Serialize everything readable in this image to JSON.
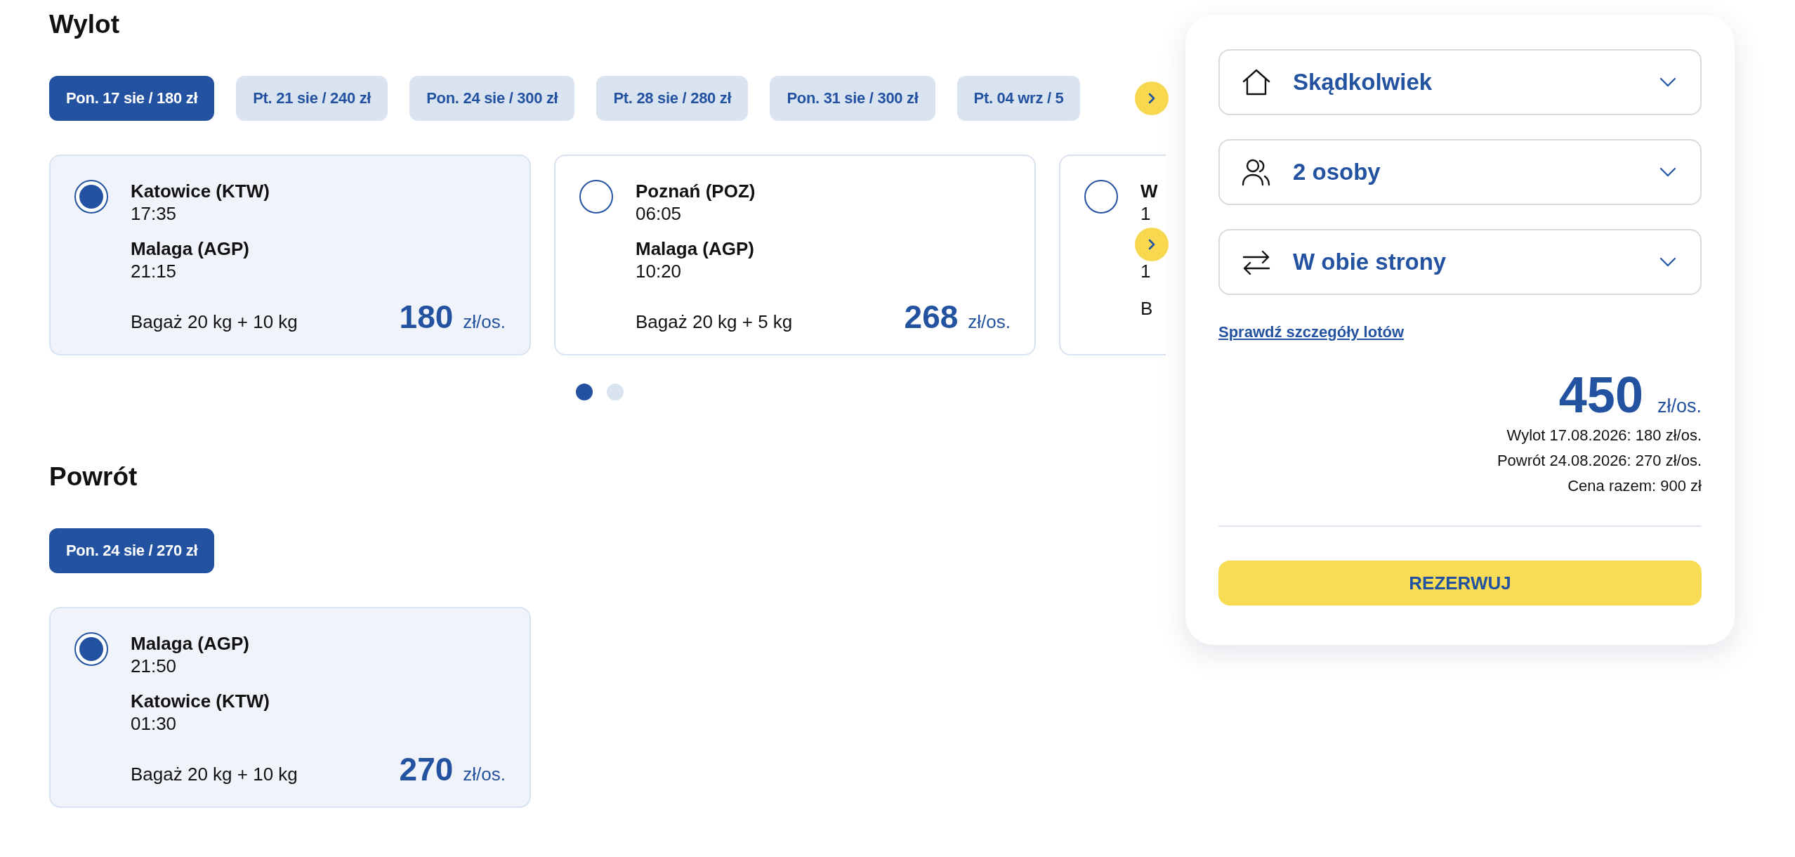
{
  "outbound": {
    "title": "Wylot",
    "dates": [
      {
        "label": "Pon. 17 sie / 180 zł",
        "selected": true
      },
      {
        "label": "Pt. 21 sie / 240 zł",
        "selected": false
      },
      {
        "label": "Pon. 24 sie / 300 zł",
        "selected": false
      },
      {
        "label": "Pt. 28 sie / 280 zł",
        "selected": false
      },
      {
        "label": "Pon. 31 sie / 300 zł",
        "selected": false
      },
      {
        "label": "Pt. 04 wrz / 5",
        "selected": false
      }
    ],
    "flights": [
      {
        "selected": true,
        "from": "Katowice (KTW)",
        "departure": "17:35",
        "to": "Malaga (AGP)",
        "arrival": "21:15",
        "baggage": "Bagaż 20 kg + 10 kg",
        "price": "180",
        "unit": "zł/os."
      },
      {
        "selected": false,
        "from": "Poznań (POZ)",
        "departure": "06:05",
        "to": "Malaga (AGP)",
        "arrival": "10:20",
        "baggage": "Bagaż 20 kg + 5 kg",
        "price": "268",
        "unit": "zł/os."
      },
      {
        "selected": false,
        "from": "W",
        "departure": "1",
        "arrival": "1",
        "baggage": "B"
      }
    ],
    "pages": [
      {
        "selected": true
      },
      {
        "selected": false
      }
    ]
  },
  "return": {
    "title": "Powrót",
    "dates": [
      {
        "label": "Pon. 24 sie / 270 zł",
        "selected": true
      }
    ],
    "flights": [
      {
        "selected": true,
        "from": "Malaga (AGP)",
        "departure": "21:50",
        "to": "Katowice (KTW)",
        "arrival": "01:30",
        "baggage": "Bagaż 20 kg + 10 kg",
        "price": "270",
        "unit": "zł/os."
      }
    ]
  },
  "summary": {
    "selects": [
      {
        "kind": "home",
        "value": "Skądkolwiek"
      },
      {
        "kind": "people",
        "value": "2 osoby"
      },
      {
        "kind": "roundtrip",
        "value": "W obie strony"
      }
    ],
    "details_link": "Sprawdź szczegóły lotów",
    "price": "450",
    "unit": "zł/os.",
    "breakdown": [
      "Wylot 17.08.2026: 180 zł/os.",
      "Powrót 24.08.2026: 270 zł/os.",
      "Cena razem: 900 zł"
    ],
    "button": "REZERWUJ"
  }
}
